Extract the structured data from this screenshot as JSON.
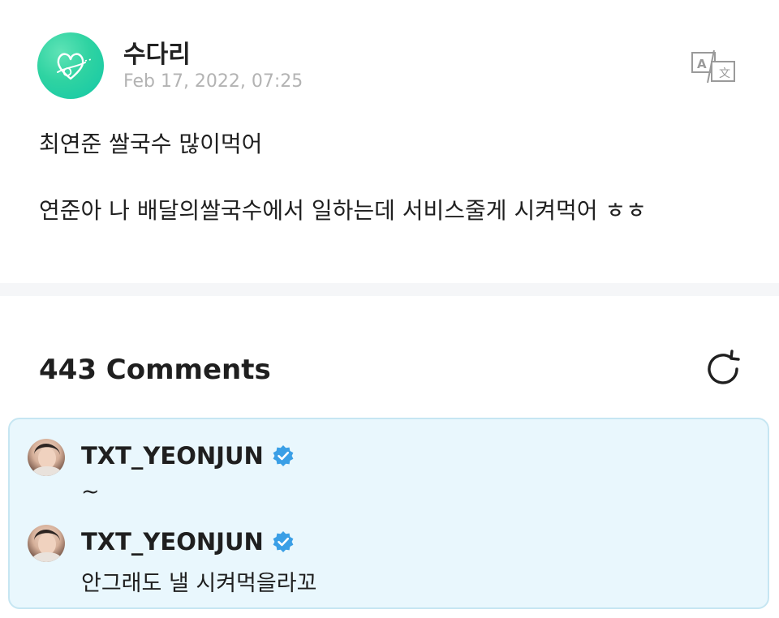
{
  "post": {
    "author_name": "수다리",
    "date": "Feb 17, 2022, 07:25",
    "lines": [
      "최연준 쌀국수 많이먹어",
      "연준아 나 배달의쌀국수에서 일하는데 서비스줄게 시켜먹어 ㅎㅎ"
    ],
    "translate_icon": "translate-icon"
  },
  "comments": {
    "count_label": "443 Comments",
    "refresh_icon": "refresh-icon",
    "artist_comments": [
      {
        "author": "TXT_YEONJUN",
        "verified": true,
        "text": "~"
      },
      {
        "author": "TXT_YEONJUN",
        "verified": true,
        "text": "안그래도 낼 시켜먹을라꼬"
      }
    ]
  },
  "colors": {
    "avatar_green": "#2fd3a2",
    "date_gray": "#b3b3b3",
    "artist_box_bg": "#e9f7fd",
    "artist_box_border": "#c6e6f2",
    "verified_blue": "#3a9fe6"
  }
}
